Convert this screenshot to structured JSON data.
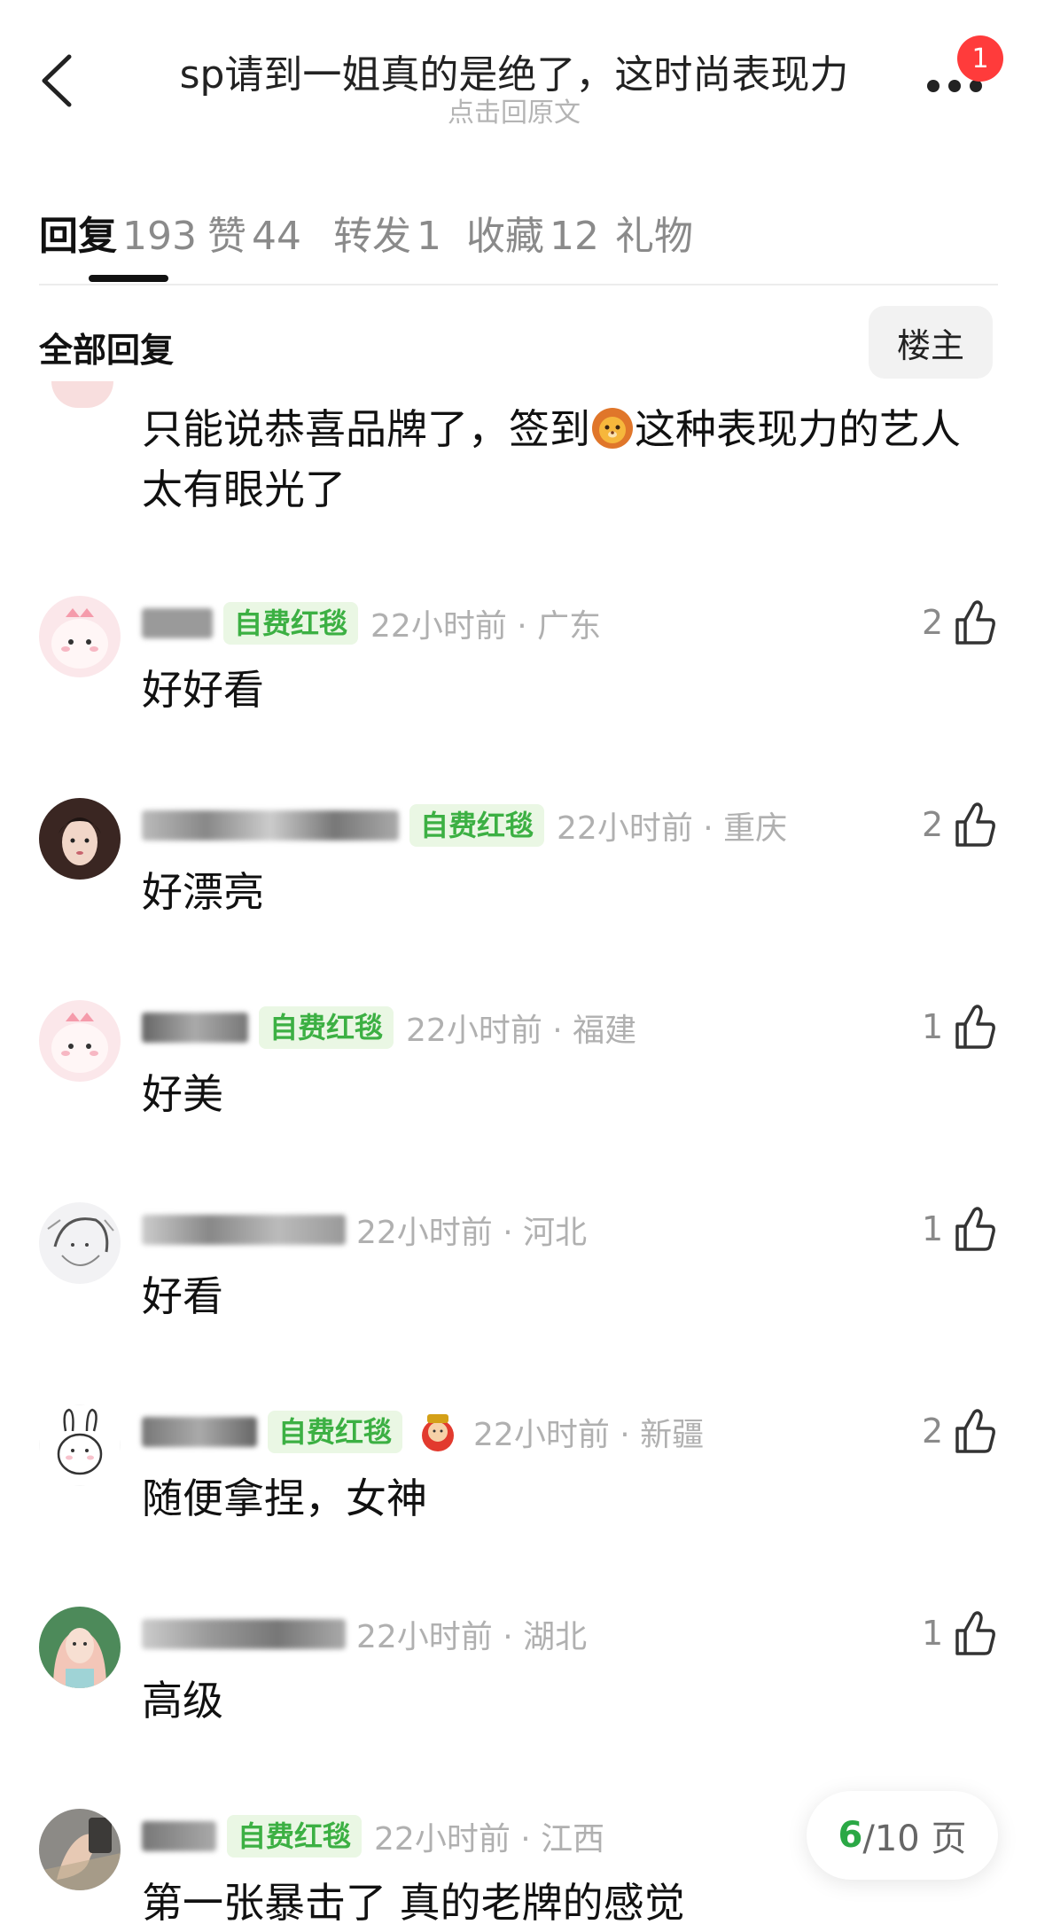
{
  "header": {
    "title": "sp请到一姐真的是绝了，这时尚表现力",
    "subtitle": "点击回原文",
    "notification_count": "1"
  },
  "tabs": [
    {
      "label": "回复",
      "count": "193",
      "active": true
    },
    {
      "label": "赞",
      "count": "44",
      "active": false
    },
    {
      "label": "转发",
      "count": "1",
      "active": false
    },
    {
      "label": "收藏",
      "count": "12",
      "active": false
    },
    {
      "label": "礼物",
      "count": "",
      "active": false
    }
  ],
  "section": {
    "title": "全部回复",
    "op_filter_label": "楼主"
  },
  "partial_comment": {
    "text_before_emoji": "只能说恭喜品牌了，签到",
    "text_after_emoji": "这种表现力的艺人太有眼光了"
  },
  "comments": [
    {
      "badge": "自费红毯",
      "time_loc": "22小时前 · 广东",
      "text": "好好看",
      "likes": "2",
      "avatar_icon": "pink-dino-avatar"
    },
    {
      "badge": "自费红毯",
      "time_loc": "22小时前 · 重庆",
      "text": "好漂亮",
      "likes": "2",
      "avatar_icon": "girl-photo-avatar"
    },
    {
      "badge": "自费红毯",
      "time_loc": "22小时前 · 福建",
      "text": "好美",
      "likes": "1",
      "avatar_icon": "pink-dino-avatar"
    },
    {
      "badge": "",
      "time_loc": "22小时前 · 河北",
      "text": "好看",
      "likes": "1",
      "avatar_icon": "anime-sketch-avatar"
    },
    {
      "badge": "自费红毯",
      "time_loc": "22小时前 · 新疆",
      "text": "随便拿捏，女神",
      "likes": "2",
      "avatar_icon": "cartoon-bunny-avatar"
    },
    {
      "badge": "",
      "time_loc": "22小时前 · 湖北",
      "text": "高级",
      "likes": "1",
      "avatar_icon": "girl-photo-avatar"
    },
    {
      "badge": "自费红毯",
      "time_loc": "22小时前 · 江西",
      "text": "第一张暴击了 真的老牌的感觉",
      "likes": "",
      "avatar_icon": "hand-photo-avatar"
    }
  ],
  "pager": {
    "current": "6",
    "total_text": "/10 页"
  },
  "colors": {
    "badge_green": "#3cb043",
    "badge_bg": "#eaf7e4",
    "notification_red": "#ff3b3b",
    "pager_current_green": "#2aa845"
  }
}
